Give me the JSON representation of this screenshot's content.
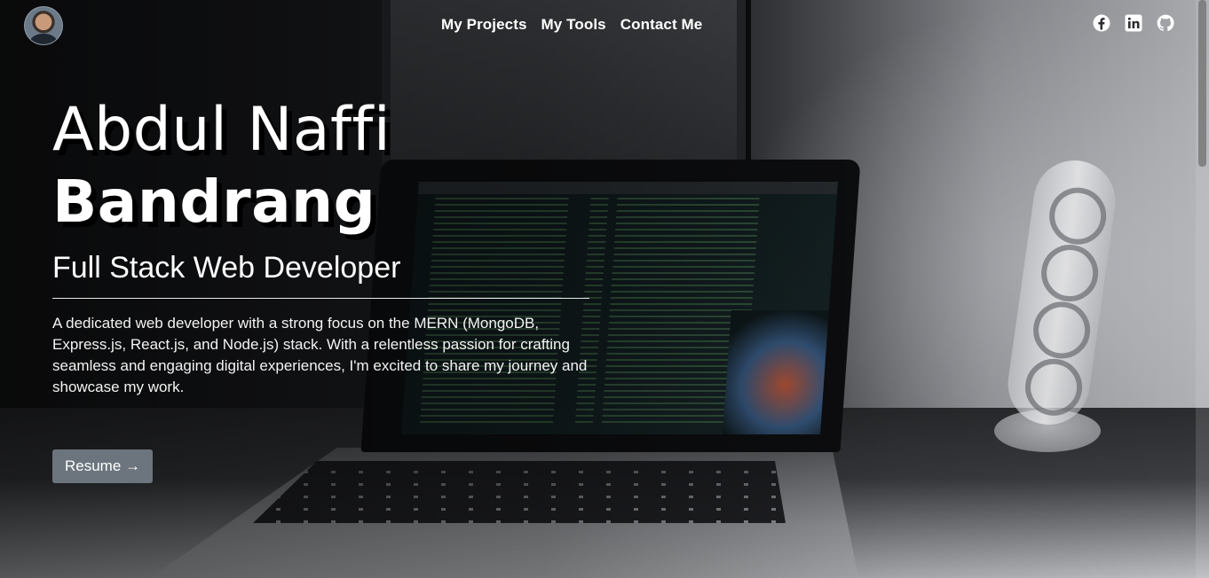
{
  "nav": {
    "links": [
      {
        "label": "My Projects"
      },
      {
        "label": "My Tools"
      },
      {
        "label": "Contact Me"
      }
    ],
    "social_icons": [
      "facebook-icon",
      "linkedin-icon",
      "github-icon"
    ]
  },
  "hero": {
    "name_first": "Abdul Naffi",
    "name_last": "Bandrang",
    "role": "Full Stack Web Developer",
    "bio": "A dedicated web developer with a strong focus on the MERN (MongoDB, Express.js, React.js, and Node.js) stack. With a relentless passion for crafting seamless and engaging digital experiences, I'm excited to share my journey and showcase my work.",
    "resume_label": "Resume →"
  },
  "colors": {
    "text": "#ffffff",
    "button_bg": "#6c757d",
    "divider": "#e9e9e9"
  }
}
